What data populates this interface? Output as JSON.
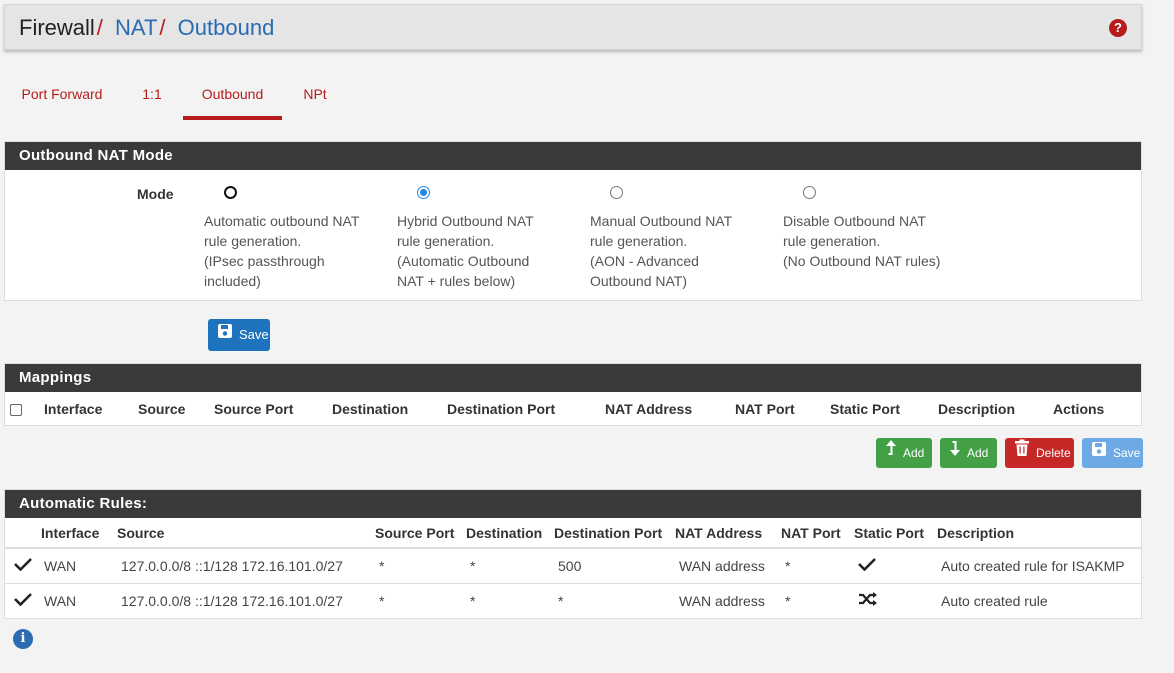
{
  "breadcrumb": {
    "root": "Firewall",
    "nat": "NAT",
    "current": "Outbound"
  },
  "tabs": [
    {
      "label": "Port Forward",
      "active": false
    },
    {
      "label": "1:1",
      "active": false
    },
    {
      "label": "Outbound",
      "active": true
    },
    {
      "label": "NPt",
      "active": false
    }
  ],
  "mode_panel": {
    "title": "Outbound NAT Mode",
    "mode_label": "Mode",
    "selected": "hybrid",
    "options": [
      {
        "id": "automatic",
        "lines": [
          "Automatic outbound NAT",
          "rule generation.",
          "(IPsec passthrough",
          "included)"
        ]
      },
      {
        "id": "hybrid",
        "lines": [
          "Hybrid Outbound NAT",
          "rule generation.",
          "(Automatic Outbound",
          "NAT + rules below)"
        ]
      },
      {
        "id": "manual",
        "lines": [
          "Manual Outbound NAT",
          "rule generation.",
          "(AON - Advanced",
          "Outbound NAT)"
        ]
      },
      {
        "id": "disable",
        "lines": [
          "Disable Outbound NAT",
          "rule generation.",
          "(No Outbound NAT rules)"
        ]
      }
    ],
    "save_label": "Save"
  },
  "mappings": {
    "title": "Mappings",
    "columns": [
      "Interface",
      "Source",
      "Source Port",
      "Destination",
      "Destination Port",
      "NAT Address",
      "NAT Port",
      "Static Port",
      "Description",
      "Actions"
    ],
    "buttons": {
      "add_top": "Add",
      "add_bottom": "Add",
      "delete": "Delete",
      "save": "Save"
    }
  },
  "automatic_rules": {
    "title": "Automatic Rules:",
    "columns": [
      "Interface",
      "Source",
      "Source Port",
      "Destination",
      "Destination Port",
      "NAT Address",
      "NAT Port",
      "Static Port",
      "Description"
    ],
    "rows": [
      {
        "interface": "WAN",
        "source": "127.0.0.0/8 ::1/128 172.16.101.0/27",
        "source_port": "*",
        "destination": "*",
        "destination_port": "500",
        "nat_address": "WAN address",
        "nat_port": "*",
        "static_port": "check-icon",
        "description": "Auto created rule for ISAKMP"
      },
      {
        "interface": "WAN",
        "source": "127.0.0.0/8 ::1/128 172.16.101.0/27",
        "source_port": "*",
        "destination": "*",
        "destination_port": "*",
        "nat_address": "WAN address",
        "nat_port": "*",
        "static_port": "shuffle-icon",
        "description": "Auto created rule"
      }
    ]
  },
  "colors": {
    "accent": "#b71c1c",
    "link": "#2a6bb1",
    "panel_header": "#3a3a3a",
    "primary": "#1e73be",
    "success": "#43a047",
    "danger": "#c62828"
  }
}
